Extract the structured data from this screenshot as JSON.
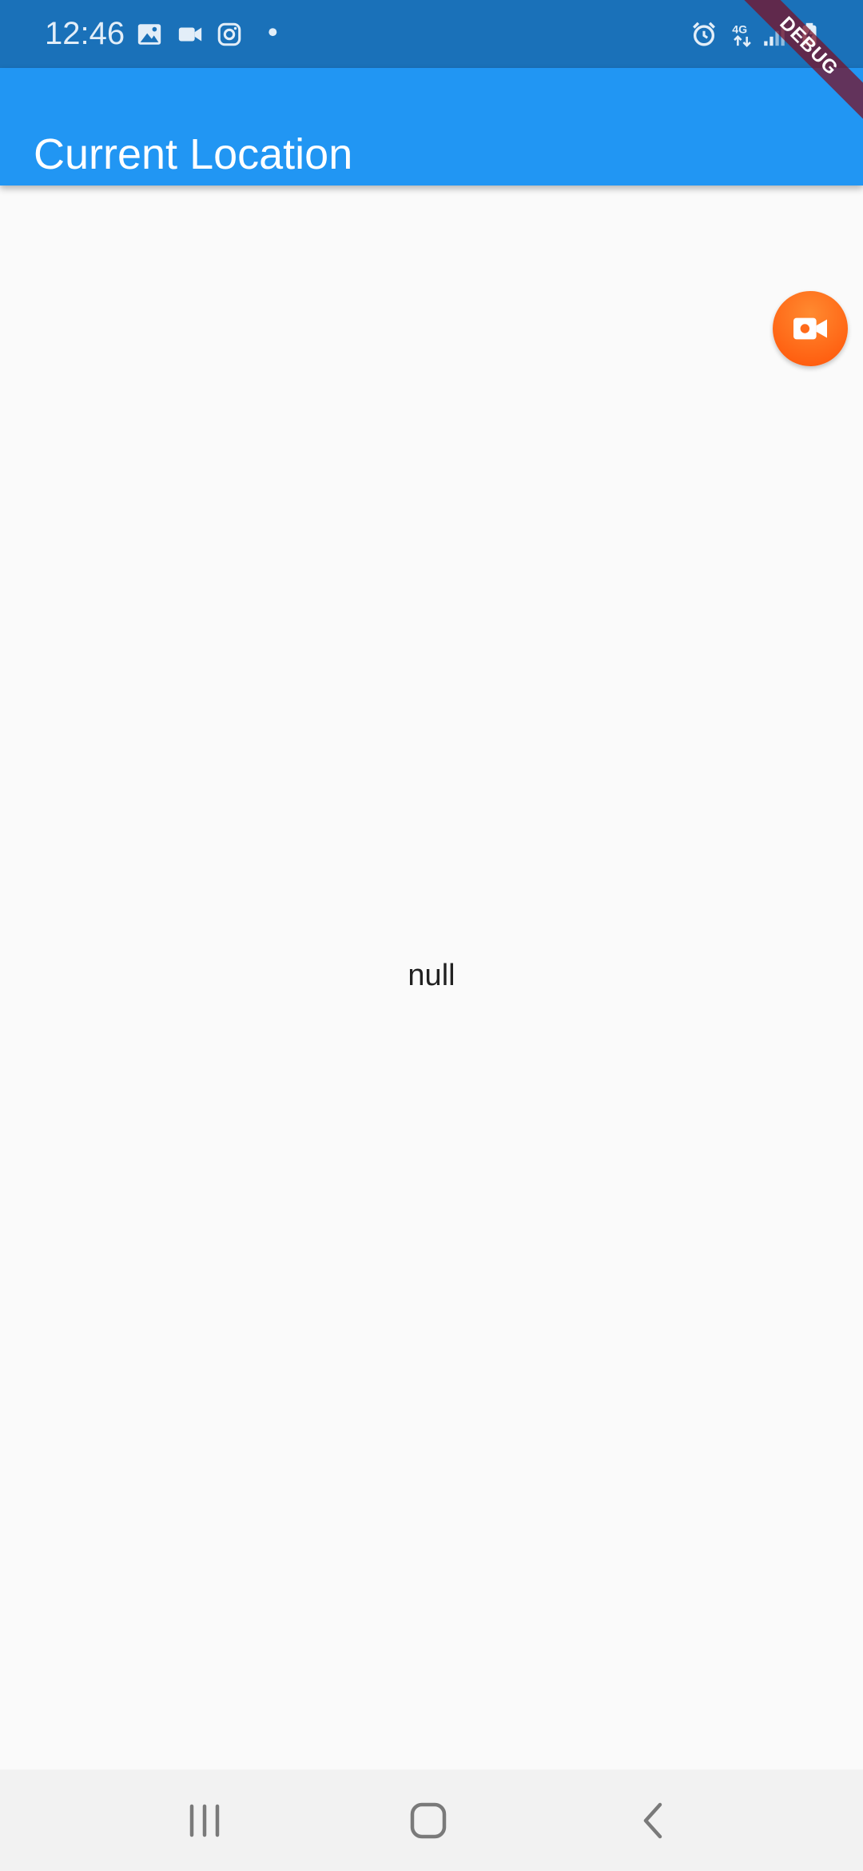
{
  "status_bar": {
    "time": "12:46",
    "left_icons": [
      "image-icon",
      "video-camera-icon",
      "instagram-icon",
      "dot-icon"
    ],
    "right_icons": [
      "alarm-icon",
      "network-4g-icon",
      "signal-icon",
      "battery-charging-icon"
    ],
    "network_label": "4G"
  },
  "app_bar": {
    "title": "Current Location",
    "color": "#2196f3"
  },
  "debug_banner": {
    "label": "DEBUG"
  },
  "fab": {
    "icon": "video-camera-icon",
    "color": "#ff6a1a"
  },
  "main": {
    "text": "null"
  },
  "nav_bar": {
    "buttons": [
      "recent-apps-icon",
      "home-icon",
      "back-icon"
    ]
  }
}
